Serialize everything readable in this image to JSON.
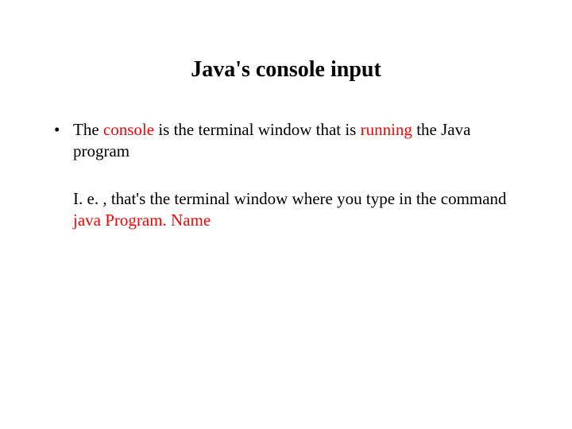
{
  "title": "Java's console input",
  "bullet": {
    "prefix": "The ",
    "console_word": "console",
    "mid": " is the terminal window that is ",
    "running_word": "running",
    "suffix": " the Java program"
  },
  "sub": {
    "prefix": "I. e. , that's the terminal window where you type in the command ",
    "cmd": "java Program. Name"
  }
}
